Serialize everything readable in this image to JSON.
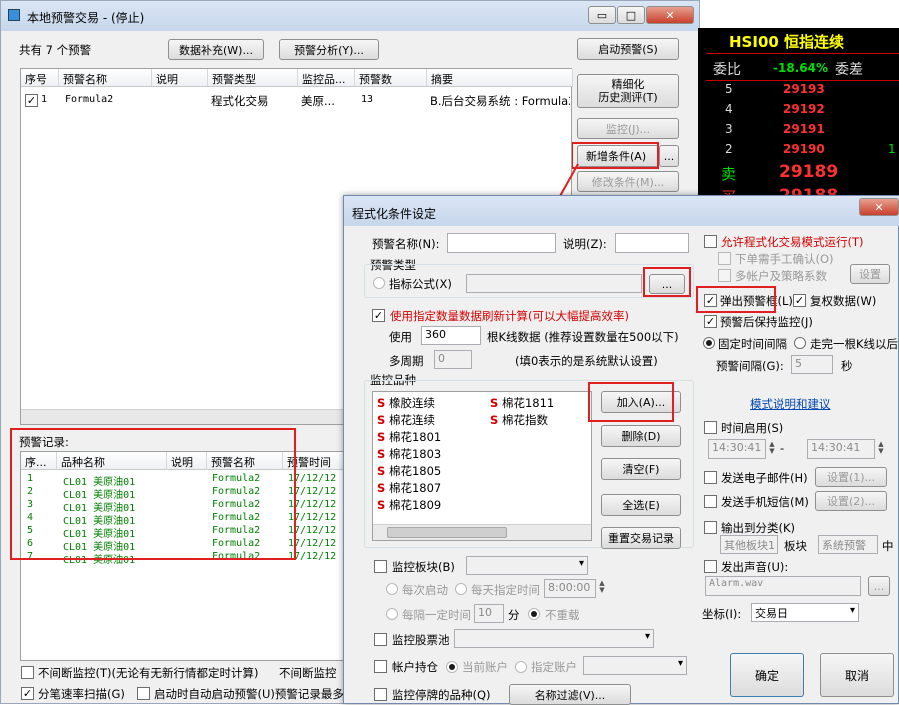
{
  "main_window": {
    "title": "本地预警交易 - (停止)",
    "minimize": "▭",
    "maximize": "□",
    "close": "✕",
    "count_label": "共有 7 个预警",
    "btn_supplement": "数据补充(W)...",
    "btn_analysis": "预警分析(Y)...",
    "btn_start": "启动预警(S)",
    "btn_refine_1": "精细化",
    "btn_refine_2": "历史测评(T)",
    "btn_monitor": "监控(J)...",
    "btn_add": "新增条件(A)",
    "btn_more": "...",
    "btn_edit": "修改条件(M)...",
    "columns": [
      "序号",
      "预警名称",
      "说明",
      "预警类型",
      "监控品...",
      "预警数",
      "摘要"
    ],
    "row": {
      "no": "1",
      "name": "Formula2",
      "desc": "",
      "type": "程式化交易",
      "monitor": "美原...",
      "count": "13",
      "summary": "B.后台交易系统 : Formula2"
    },
    "records_title": "预警记录:",
    "record_columns": [
      "序...",
      "品种名称",
      "说明",
      "预警名称",
      "预警时间"
    ],
    "records": [
      {
        "no": "1",
        "symbol": "CL01 美原油01",
        "name": "Formula2",
        "time": "17/12/12"
      },
      {
        "no": "2",
        "symbol": "CL01 美原油01",
        "name": "Formula2",
        "time": "17/12/12"
      },
      {
        "no": "3",
        "symbol": "CL01 美原油01",
        "name": "Formula2",
        "time": "17/12/12"
      },
      {
        "no": "4",
        "symbol": "CL01 美原油01",
        "name": "Formula2",
        "time": "17/12/12"
      },
      {
        "no": "5",
        "symbol": "CL01 美原油01",
        "name": "Formula2",
        "time": "17/12/12"
      },
      {
        "no": "6",
        "symbol": "CL01 美原油01",
        "name": "Formula2",
        "time": "17/12/12"
      },
      {
        "no": "7",
        "symbol": "CL01 美原油01",
        "name": "Formula2",
        "time": "17/12/12"
      }
    ],
    "opt_continuous": "不间断监控(T)(无论有无新行情都定时计算)",
    "opt_continuous_2": "不间断监控",
    "opt_tick": "分笔速率扫描(G)",
    "opt_autostart": "启动时自动启动预警(U)预警记录最多"
  },
  "quote": {
    "title": "HSI00 恒指连续",
    "wei_bi": "委比",
    "wei_bi_val": "-18.64%",
    "wei_cha": "委差",
    "rows": [
      {
        "lvl": "5",
        "price": "29193",
        "vol": ""
      },
      {
        "lvl": "4",
        "price": "29192",
        "vol": ""
      },
      {
        "lvl": "3",
        "price": "29191",
        "vol": ""
      },
      {
        "lvl": "2",
        "price": "29190",
        "vol": "1"
      }
    ],
    "sell": "卖",
    "sell_price": "29189",
    "buy_partial": "买",
    "buy_price_partial": "29188"
  },
  "dialog": {
    "title": "程式化条件设定",
    "close": "✕",
    "name_label": "预警名称(N):",
    "name_value": "",
    "desc_label": "说明(Z):",
    "desc_value": "",
    "type_group": "预警类型",
    "indicator": "指标公式(X)",
    "dots": "...",
    "use_count": "使用指定数量数据刷新计算(可以大幅提高效率)",
    "use": "使用",
    "bars": "360",
    "bars_hint": "根K线数据 (推荐设置数量在500以下)",
    "multi_period": "多周期",
    "multi_value": "0",
    "multi_hint": "(填0表示的是系统默认设置)",
    "monitor_group": "监控品种",
    "symbols_left": [
      "橡胶连续",
      "棉花连续",
      "棉花1801",
      "棉花1803",
      "棉花1805",
      "棉花1807",
      "棉花1809"
    ],
    "symbols_right": [
      "棉花1811",
      "棉花指数"
    ],
    "s_mark": "S",
    "btn_join": "加入(A)...",
    "btn_delete": "删除(D)",
    "btn_clear": "清空(F)",
    "btn_selall": "全选(E)",
    "btn_reset": "重置交易记录",
    "monitor_board": "监控板块(B)",
    "every_start": "每次启动",
    "daily_time": "每天指定时间",
    "daily_val": "8:00:00",
    "every_interval": "每隔一定时间",
    "interval_val": "10",
    "minute": "分",
    "no_repeat": "不重载",
    "stock_pool": "监控股票池",
    "account_pos": "帐户持仓",
    "cur_account": "当前账户",
    "spec_account": "指定账户",
    "monitor_halt": "监控停牌的品种(Q)",
    "name_filter": "名称过滤(V)...",
    "allow_prog": "允许程式化交易模式运行(T)",
    "manual_confirm": "下单需手工确认(O)",
    "multi_acct": "多帐户及策略系数",
    "btn_setting": "设置",
    "popup": "弹出预警框(L)",
    "reauth": "复权数据(W)",
    "keep_monitor": "预警后保持监控(J)",
    "fixed_interval": "固定时间间隔",
    "after_bar": "走完一根K线以后",
    "alert_interval": "预警间隔(G):",
    "interval_secs": "5",
    "second": "秒",
    "model_link": "模式说明和建议",
    "time_enable": "时间启用(S)",
    "t_from": "14:30:41",
    "t_to": "14:30:41",
    "send_email": "发送电子邮件(H)",
    "set1": "设置(1)...",
    "send_sms": "发送手机短信(M)",
    "set2": "设置(2)...",
    "output_cat": "输出到分类(K)",
    "other_board": "其他板块1",
    "board": "板块",
    "sys_alert": "系统预警",
    "mid": "中",
    "play_sound": "发出声音(U):",
    "sound_file": "Alarm.wav",
    "coord": "坐标(I):",
    "coord_val": "交易日",
    "ok": "确定",
    "cancel": "取消"
  }
}
